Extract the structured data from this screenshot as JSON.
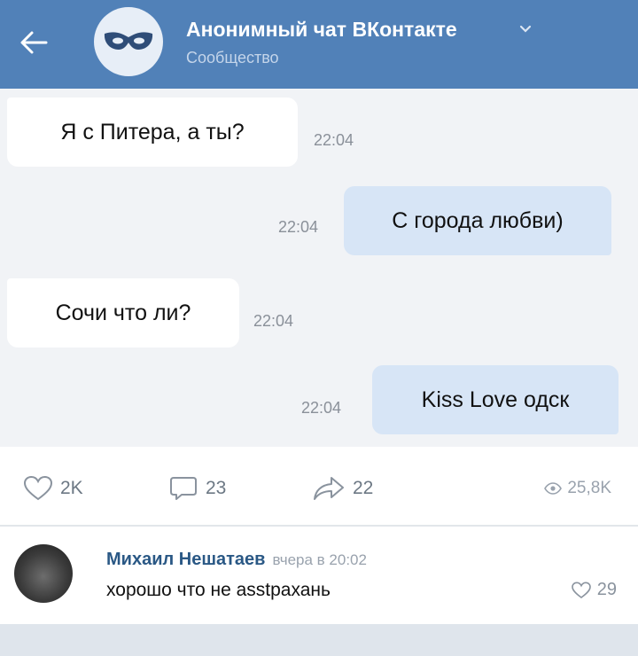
{
  "header": {
    "title": "Анонимный чат ВКонтакте",
    "subtitle": "Сообщество",
    "icons": {
      "back": "arrow-left-icon",
      "avatar": "mask-icon",
      "dropdown": "chevron-down-icon"
    }
  },
  "messages": [
    {
      "direction": "incoming",
      "text": "Я с Питера, а ты?",
      "time": "22:04"
    },
    {
      "direction": "outgoing",
      "text": "С города любви)",
      "time": "22:04"
    },
    {
      "direction": "incoming",
      "text": "Сочи что ли?",
      "time": "22:04"
    },
    {
      "direction": "outgoing",
      "text": "Kiss Love одск",
      "time": "22:04"
    }
  ],
  "post_actions": {
    "likes": "2K",
    "comments": "23",
    "shares": "22",
    "views": "25,8K"
  },
  "comment": {
    "author": "Михаил Нешатаев",
    "date": "вчера в 20:02",
    "text": "хорошо что не аsstрахань",
    "likes": "29"
  },
  "colors": {
    "header_bg": "#5181b8",
    "chat_bg": "#f1f3f6",
    "incoming_bubble": "#ffffff",
    "outgoing_bubble": "#d7e5f6",
    "author_link": "#2a5885"
  }
}
